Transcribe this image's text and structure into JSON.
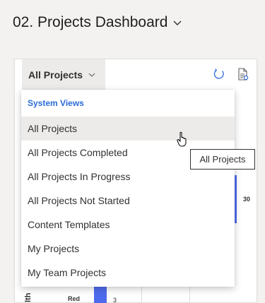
{
  "header": {
    "title": "02. Projects Dashboard"
  },
  "toolbar": {
    "view_selector": "All Projects"
  },
  "dropdown": {
    "section_header": "System Views",
    "items": [
      {
        "label": "All Projects",
        "selected": true
      },
      {
        "label": "All Projects Completed"
      },
      {
        "label": "All Projects In Progress"
      },
      {
        "label": "All Projects Not Started"
      },
      {
        "label": "Content Templates"
      },
      {
        "label": "My Projects"
      },
      {
        "label": "My Team Projects"
      }
    ]
  },
  "tooltip": {
    "text": "All Projects"
  },
  "chart_fragments": {
    "value_30": "30",
    "bottom_category": "Red",
    "bottom_value": "3",
    "axis_label": "lth"
  },
  "colors": {
    "accent": "#4f6bed",
    "link_blue": "#2b6bd8",
    "selected_bg": "#edebe9"
  },
  "icons": [
    "chevron-down-icon",
    "refresh-icon",
    "export-icon",
    "hand-cursor-icon"
  ]
}
